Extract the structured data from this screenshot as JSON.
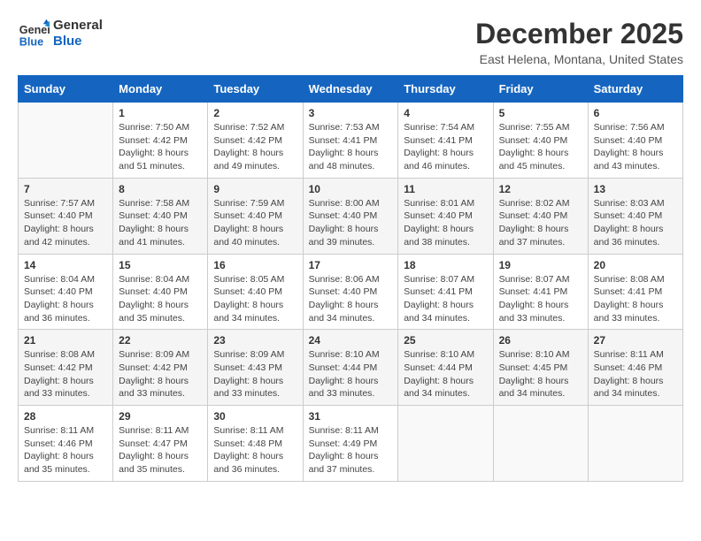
{
  "header": {
    "logo_line1": "General",
    "logo_line2": "Blue",
    "month_title": "December 2025",
    "location": "East Helena, Montana, United States"
  },
  "days_of_week": [
    "Sunday",
    "Monday",
    "Tuesday",
    "Wednesday",
    "Thursday",
    "Friday",
    "Saturday"
  ],
  "weeks": [
    [
      {
        "day": "",
        "info": ""
      },
      {
        "day": "1",
        "info": "Sunrise: 7:50 AM\nSunset: 4:42 PM\nDaylight: 8 hours\nand 51 minutes."
      },
      {
        "day": "2",
        "info": "Sunrise: 7:52 AM\nSunset: 4:42 PM\nDaylight: 8 hours\nand 49 minutes."
      },
      {
        "day": "3",
        "info": "Sunrise: 7:53 AM\nSunset: 4:41 PM\nDaylight: 8 hours\nand 48 minutes."
      },
      {
        "day": "4",
        "info": "Sunrise: 7:54 AM\nSunset: 4:41 PM\nDaylight: 8 hours\nand 46 minutes."
      },
      {
        "day": "5",
        "info": "Sunrise: 7:55 AM\nSunset: 4:40 PM\nDaylight: 8 hours\nand 45 minutes."
      },
      {
        "day": "6",
        "info": "Sunrise: 7:56 AM\nSunset: 4:40 PM\nDaylight: 8 hours\nand 43 minutes."
      }
    ],
    [
      {
        "day": "7",
        "info": "Sunrise: 7:57 AM\nSunset: 4:40 PM\nDaylight: 8 hours\nand 42 minutes."
      },
      {
        "day": "8",
        "info": "Sunrise: 7:58 AM\nSunset: 4:40 PM\nDaylight: 8 hours\nand 41 minutes."
      },
      {
        "day": "9",
        "info": "Sunrise: 7:59 AM\nSunset: 4:40 PM\nDaylight: 8 hours\nand 40 minutes."
      },
      {
        "day": "10",
        "info": "Sunrise: 8:00 AM\nSunset: 4:40 PM\nDaylight: 8 hours\nand 39 minutes."
      },
      {
        "day": "11",
        "info": "Sunrise: 8:01 AM\nSunset: 4:40 PM\nDaylight: 8 hours\nand 38 minutes."
      },
      {
        "day": "12",
        "info": "Sunrise: 8:02 AM\nSunset: 4:40 PM\nDaylight: 8 hours\nand 37 minutes."
      },
      {
        "day": "13",
        "info": "Sunrise: 8:03 AM\nSunset: 4:40 PM\nDaylight: 8 hours\nand 36 minutes."
      }
    ],
    [
      {
        "day": "14",
        "info": "Sunrise: 8:04 AM\nSunset: 4:40 PM\nDaylight: 8 hours\nand 36 minutes."
      },
      {
        "day": "15",
        "info": "Sunrise: 8:04 AM\nSunset: 4:40 PM\nDaylight: 8 hours\nand 35 minutes."
      },
      {
        "day": "16",
        "info": "Sunrise: 8:05 AM\nSunset: 4:40 PM\nDaylight: 8 hours\nand 34 minutes."
      },
      {
        "day": "17",
        "info": "Sunrise: 8:06 AM\nSunset: 4:40 PM\nDaylight: 8 hours\nand 34 minutes."
      },
      {
        "day": "18",
        "info": "Sunrise: 8:07 AM\nSunset: 4:41 PM\nDaylight: 8 hours\nand 34 minutes."
      },
      {
        "day": "19",
        "info": "Sunrise: 8:07 AM\nSunset: 4:41 PM\nDaylight: 8 hours\nand 33 minutes."
      },
      {
        "day": "20",
        "info": "Sunrise: 8:08 AM\nSunset: 4:41 PM\nDaylight: 8 hours\nand 33 minutes."
      }
    ],
    [
      {
        "day": "21",
        "info": "Sunrise: 8:08 AM\nSunset: 4:42 PM\nDaylight: 8 hours\nand 33 minutes."
      },
      {
        "day": "22",
        "info": "Sunrise: 8:09 AM\nSunset: 4:42 PM\nDaylight: 8 hours\nand 33 minutes."
      },
      {
        "day": "23",
        "info": "Sunrise: 8:09 AM\nSunset: 4:43 PM\nDaylight: 8 hours\nand 33 minutes."
      },
      {
        "day": "24",
        "info": "Sunrise: 8:10 AM\nSunset: 4:44 PM\nDaylight: 8 hours\nand 33 minutes."
      },
      {
        "day": "25",
        "info": "Sunrise: 8:10 AM\nSunset: 4:44 PM\nDaylight: 8 hours\nand 34 minutes."
      },
      {
        "day": "26",
        "info": "Sunrise: 8:10 AM\nSunset: 4:45 PM\nDaylight: 8 hours\nand 34 minutes."
      },
      {
        "day": "27",
        "info": "Sunrise: 8:11 AM\nSunset: 4:46 PM\nDaylight: 8 hours\nand 34 minutes."
      }
    ],
    [
      {
        "day": "28",
        "info": "Sunrise: 8:11 AM\nSunset: 4:46 PM\nDaylight: 8 hours\nand 35 minutes."
      },
      {
        "day": "29",
        "info": "Sunrise: 8:11 AM\nSunset: 4:47 PM\nDaylight: 8 hours\nand 35 minutes."
      },
      {
        "day": "30",
        "info": "Sunrise: 8:11 AM\nSunset: 4:48 PM\nDaylight: 8 hours\nand 36 minutes."
      },
      {
        "day": "31",
        "info": "Sunrise: 8:11 AM\nSunset: 4:49 PM\nDaylight: 8 hours\nand 37 minutes."
      },
      {
        "day": "",
        "info": ""
      },
      {
        "day": "",
        "info": ""
      },
      {
        "day": "",
        "info": ""
      }
    ]
  ]
}
